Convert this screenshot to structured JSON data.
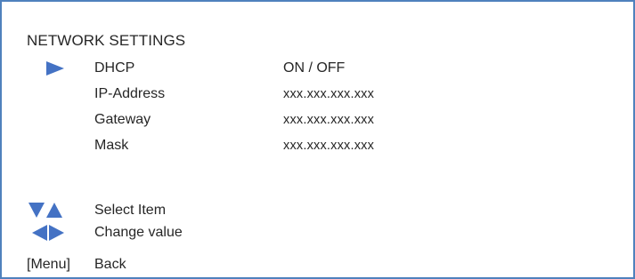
{
  "screen": {
    "title": "NETWORK SETTINGS",
    "accent_color": "#4472c4",
    "border_color": "#4f81bd"
  },
  "settings": [
    {
      "label": "DHCP",
      "value": "ON / OFF",
      "selected": true
    },
    {
      "label": "IP-Address",
      "value": "xxx.xxx.xxx.xxx",
      "selected": false
    },
    {
      "label": "Gateway",
      "value": "xxx.xxx.xxx.xxx",
      "selected": false
    },
    {
      "label": "Mask",
      "value": "xxx.xxx.xxx.xxx",
      "selected": false
    }
  ],
  "legend": {
    "select": {
      "icon": "up-down-arrows-icon",
      "text": "Select Item"
    },
    "change": {
      "icon": "left-right-arrows-icon",
      "text": "Change value"
    },
    "back": {
      "key": "[Menu]",
      "text": "Back"
    }
  }
}
